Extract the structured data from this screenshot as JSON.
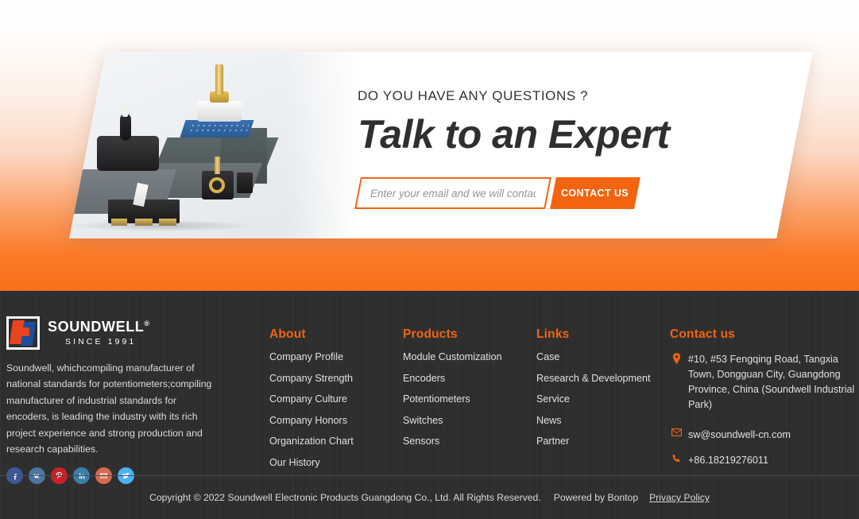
{
  "colors": {
    "accent_orange": "#f2640f",
    "footer_bg": "#2e2e2e",
    "heading_dark": "#2f2f2f"
  },
  "cta": {
    "eyebrow": "DO YOU HAVE ANY QUESTIONS ?",
    "title": "Talk to an Expert",
    "email_placeholder": "Enter your email and we will contact you",
    "email_value": "",
    "button_label": "CONTACT US",
    "product_image_alt": "Assorted potentiometers, rotary encoders and micro switches on grey display blocks"
  },
  "footer": {
    "brand": {
      "name": "SOUNDWELL",
      "registered": "®",
      "since": "SINCE 1991",
      "description": "Soundwell, whichcompiling manufacturer of national standards for potentiometers;compiling manufacturer of industrial standards for encoders, is leading the industry with its rich project experience and strong production and research capabilities.",
      "social": [
        {
          "name": "facebook",
          "label": "f"
        },
        {
          "name": "vk",
          "label": "vk"
        },
        {
          "name": "pinterest",
          "label": "P"
        },
        {
          "name": "linkedin",
          "label": "in"
        },
        {
          "name": "email",
          "label": "✉"
        },
        {
          "name": "twitter",
          "label": "t"
        }
      ]
    },
    "columns": [
      {
        "heading": "About",
        "links": [
          "Company Profile",
          "Company Strength",
          "Company Culture",
          "Company Honors",
          "Organization Chart",
          "Our History"
        ]
      },
      {
        "heading": "Products",
        "links": [
          "Module Customization",
          "Encoders",
          "Potentiometers",
          "Switches",
          "Sensors"
        ]
      },
      {
        "heading": "Links",
        "links": [
          "Case",
          "Research & Development",
          "Service",
          "News",
          "Partner"
        ]
      }
    ],
    "contact": {
      "heading": "Contact us",
      "address": "#10, #53 Fengqing Road, Tangxia Town, Dongguan City, Guangdong Province, China (Soundwell Industrial Park)",
      "email": "sw@soundwell-cn.com",
      "phone": "+86.18219276011"
    },
    "bottom": {
      "copyright": "Copyright © 2022 Soundwell Electronic Products Guangdong Co., Ltd. All Rights Reserved.",
      "powered_by": "Powered by Bontop",
      "privacy": "Privacy Policy"
    }
  }
}
